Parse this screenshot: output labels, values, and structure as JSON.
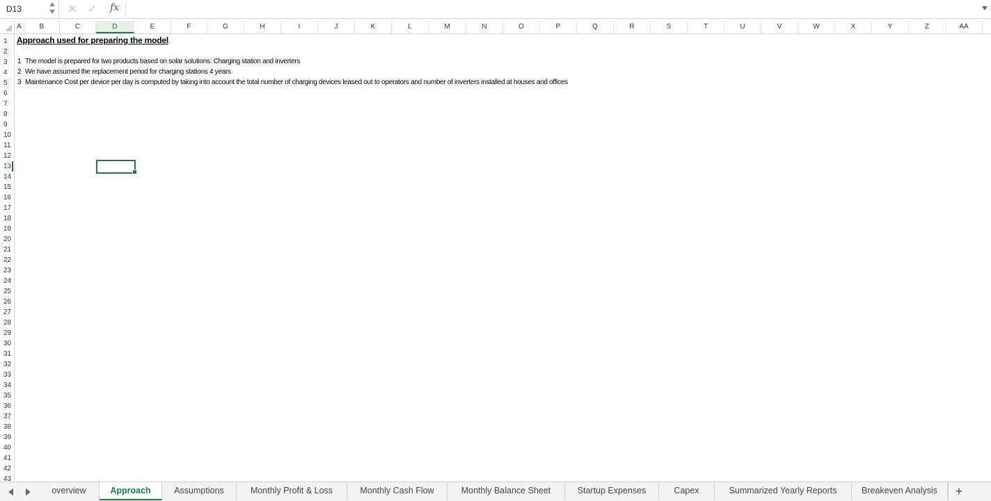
{
  "formula_bar": {
    "name_box": "D13",
    "cancel_icon": "x-icon",
    "confirm_icon": "check-icon",
    "fx_label": "fx",
    "formula": ""
  },
  "columns": [
    "A",
    "B",
    "C",
    "D",
    "E",
    "F",
    "G",
    "H",
    "I",
    "J",
    "K",
    "L",
    "M",
    "N",
    "O",
    "P",
    "Q",
    "R",
    "S",
    "T",
    "U",
    "V",
    "W",
    "X",
    "Y",
    "Z",
    "AA"
  ],
  "selected_column": "D",
  "rows": [
    "1",
    "2",
    "3",
    "4",
    "5",
    "6",
    "7",
    "8",
    "9",
    "10",
    "11",
    "12",
    "13",
    "14",
    "15",
    "16",
    "17",
    "18",
    "19",
    "20",
    "21",
    "22",
    "23",
    "24",
    "25",
    "26",
    "27",
    "28",
    "29",
    "30",
    "31",
    "32",
    "33",
    "34",
    "35",
    "36",
    "37",
    "38",
    "39",
    "40",
    "41",
    "42",
    "43"
  ],
  "selected_row": "13",
  "sheet": {
    "title": "Approach used for preparing the model",
    "notes": [
      {
        "num": "1",
        "text": "The model is prepared for two products based on solar solutions: Charging station and inverters"
      },
      {
        "num": "2",
        "text": "We have assumed the replacement period for charging stations 4 years"
      },
      {
        "num": "3",
        "text": "Maintenance Cost per device per day is computed by taking into account the total number of charging devices leased out to operators and number of inverters installed at houses and offices"
      }
    ]
  },
  "tabs": [
    "overview",
    "Approach",
    "Assumptions",
    "Monthly Profit & Loss",
    "Monthly Cash Flow",
    "Monthly Balance Sheet",
    "Startup Expenses",
    "Capex",
    "Summarized Yearly Reports",
    "Breakeven Analysis"
  ],
  "active_tab": "Approach",
  "add_tab_label": "+",
  "accent_color": "#1d7a45"
}
